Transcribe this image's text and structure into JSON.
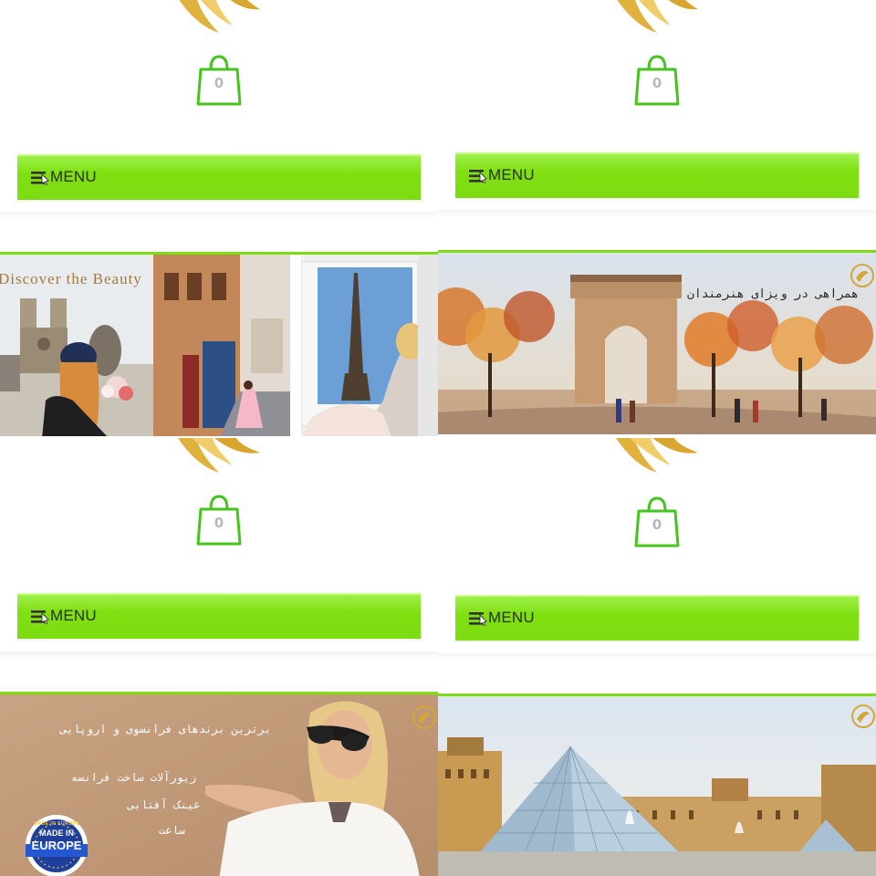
{
  "tiles": [
    {
      "cart_count": "0",
      "menu_label": "MENU"
    },
    {
      "cart_count": "0",
      "menu_label": "MENU"
    },
    {
      "cart_count": "0",
      "menu_label": "MENU"
    },
    {
      "cart_count": "0",
      "menu_label": "MENU"
    }
  ],
  "banners": {
    "discover": {
      "headline": "Discover the Beauty"
    },
    "artists": {
      "headline": "همراهی در ویزای هنرمندان"
    },
    "brands": {
      "headline": "برترین برندهای فرانسوی و اروپایی",
      "items": [
        "زیورآلات ساخت فرانسه",
        "عینک آفتابی",
        "ساعت"
      ],
      "badge_top": "MADE IN EUROPE",
      "badge_main": "MADE IN",
      "badge_sub": "EUROPE"
    }
  },
  "colors": {
    "menu_green": "#7edc12",
    "cart_green": "#46c41d",
    "logo_gold": "#e2b43f"
  }
}
